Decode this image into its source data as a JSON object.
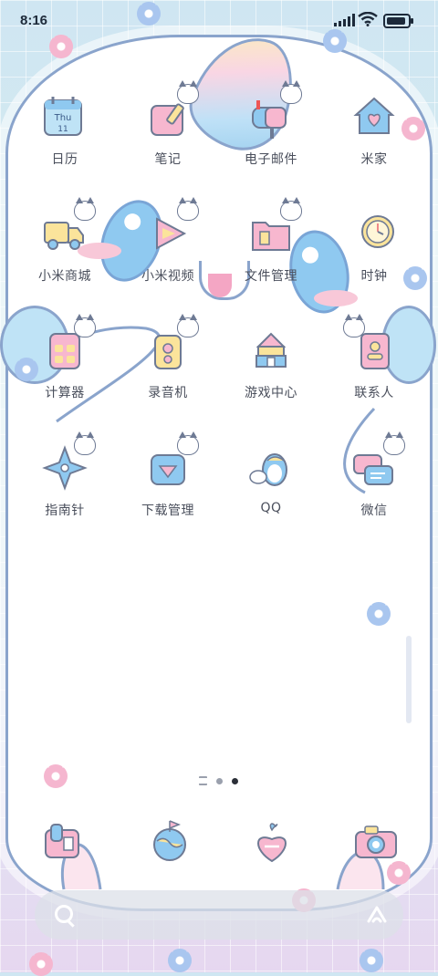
{
  "status_bar": {
    "time": "8:16"
  },
  "apps": [
    {
      "label": "日历",
      "icon": "calendar-icon",
      "day": "Thu",
      "date": "11"
    },
    {
      "label": "笔记",
      "icon": "notes-icon"
    },
    {
      "label": "电子邮件",
      "icon": "email-icon"
    },
    {
      "label": "米家",
      "icon": "home-icon"
    },
    {
      "label": "小米商城",
      "icon": "truck-icon"
    },
    {
      "label": "小米视频",
      "icon": "video-icon"
    },
    {
      "label": "文件管理",
      "icon": "folder-icon"
    },
    {
      "label": "时钟",
      "icon": "clock-icon"
    },
    {
      "label": "计算器",
      "icon": "calculator-icon"
    },
    {
      "label": "录音机",
      "icon": "recorder-icon"
    },
    {
      "label": "游戏中心",
      "icon": "game-castle-icon"
    },
    {
      "label": "联系人",
      "icon": "contacts-icon"
    },
    {
      "label": "指南针",
      "icon": "compass-icon"
    },
    {
      "label": "下载管理",
      "icon": "download-icon"
    },
    {
      "label": "QQ",
      "icon": "qq-penguin-icon"
    },
    {
      "label": "微信",
      "icon": "wechat-icon"
    }
  ],
  "page_indicator": {
    "pages": 2,
    "active": 2
  },
  "dock": [
    {
      "icon": "phone-icon"
    },
    {
      "icon": "browser-globe-icon"
    },
    {
      "icon": "message-icon"
    },
    {
      "icon": "camera-icon"
    }
  ],
  "colors": {
    "outline": "#8aa4cc",
    "pink": "#f5b6cf",
    "blue": "#8fc9f0",
    "yellow": "#fbe49b",
    "label": "#4a4f5c"
  }
}
